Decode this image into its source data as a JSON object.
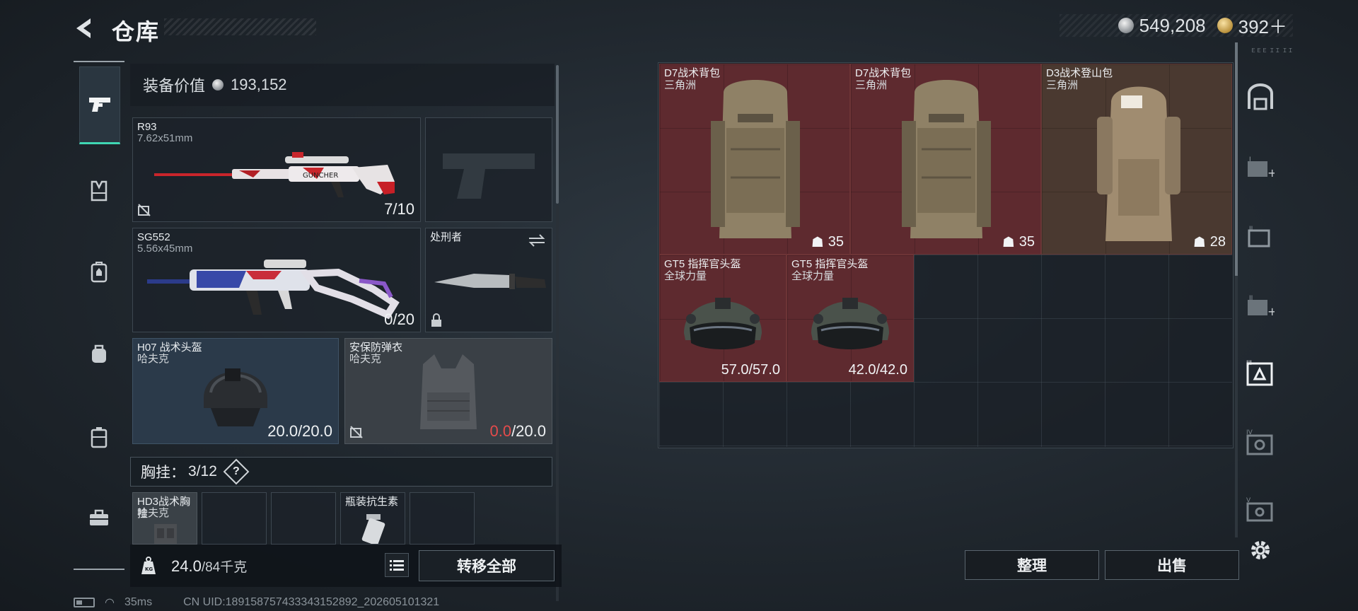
{
  "header": {
    "title": "仓库",
    "currency": [
      {
        "amount": "549,208",
        "icon": "silver-coin-icon"
      },
      {
        "amount": "392＋",
        "icon": "gold-coin-icon"
      }
    ]
  },
  "left_nav": {
    "items": [
      {
        "name": "weapons",
        "icon": "pistol-icon",
        "active": true
      },
      {
        "name": "vest",
        "icon": "vest-icon"
      },
      {
        "name": "backpack-tactical",
        "icon": "backpack-icon"
      },
      {
        "name": "bag",
        "icon": "bag-icon"
      },
      {
        "name": "case",
        "icon": "case-icon"
      },
      {
        "name": "toolbox",
        "icon": "toolbox-icon"
      }
    ]
  },
  "loadout": {
    "equip_value_label": "装备价值",
    "equip_value": "193,152",
    "primary": {
      "name": "R93",
      "caliber": "7.62x51mm",
      "ammo": "7/10"
    },
    "sidearm": {
      "name": ""
    },
    "secondary": {
      "name": "SG552",
      "caliber": "5.56x45mm",
      "ammo": "0/20"
    },
    "melee": {
      "name": "处刑者"
    },
    "helmet": {
      "name": "H07 战术头盔",
      "source": "哈夫克",
      "durability": "20.0/20.0"
    },
    "armor": {
      "name": "安保防弹衣",
      "source": "哈夫克",
      "durability_current": "0.0",
      "durability_max": "/20.0"
    },
    "vest_bar": {
      "label": "胸挂：",
      "count": "3/12",
      "help": "?"
    },
    "vest_slots": [
      {
        "name": "HD3战术胸挂",
        "sub": "哈夫克"
      },
      {
        "name": "",
        "sub": ""
      },
      {
        "name": "",
        "sub": ""
      },
      {
        "name": "瓶装抗生素",
        "sub": ""
      },
      {
        "name": "",
        "sub": ""
      }
    ],
    "weight_current": "24.0",
    "weight_max": "/84千克",
    "transfer_all": "转移全部"
  },
  "stash": {
    "items": [
      {
        "name": "D7战术背包",
        "sub": "三角洲",
        "capacity": "35"
      },
      {
        "name": "D7战术背包",
        "sub": "三角洲",
        "capacity": "35"
      },
      {
        "name": "D3战术登山包",
        "sub": "三角洲",
        "capacity": "28"
      },
      {
        "name": "GT5 指挥官头盔",
        "sub": "全球力量",
        "durability": "57.0/57.0"
      },
      {
        "name": "GT5 指挥官头盔",
        "sub": "全球力量",
        "durability": "42.0/42.0"
      }
    ],
    "sort_label": "整理",
    "sell_label": "出售"
  },
  "right_nav": {
    "tiny_label": "ＥＥＥ ＩＩ ＩＩ",
    "items": [
      "stash-main-icon",
      "stash-add-1-icon",
      "stash-ii-icon",
      "stash-add-2-icon",
      "stash-iii-icon",
      "stash-iv-icon",
      "stash-v-icon",
      "settings-icon"
    ]
  },
  "status_bar": {
    "ping": "35ms",
    "uid": "CN UID:1891587574333431528​92_202605101321"
  },
  "colors": {
    "accent": "#3fd6b3",
    "item_red": "#5e2a2f",
    "item_brown": "#4a3930",
    "durability_red": "#e54b4b"
  }
}
